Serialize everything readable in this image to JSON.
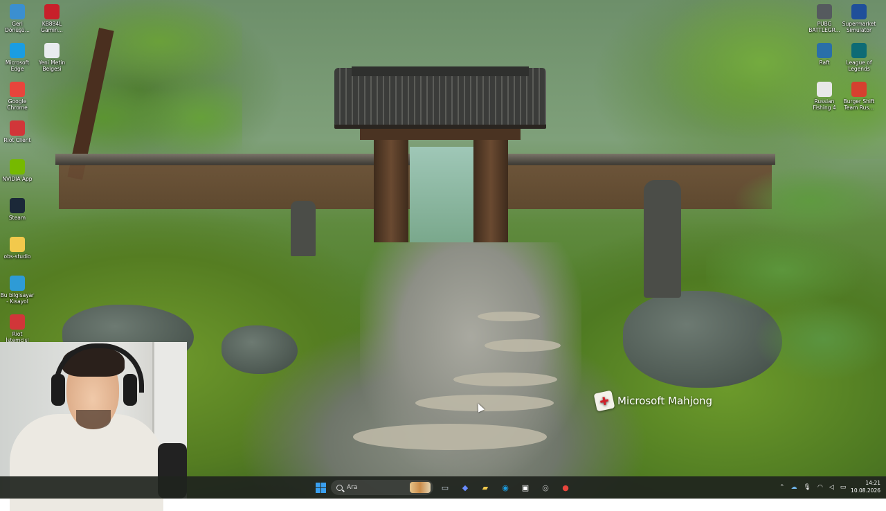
{
  "desktop_icons_left": [
    {
      "label": "Geri Dönüşü...",
      "icon": "recycle-bin-icon",
      "color": "#3b8fd0"
    },
    {
      "label": "KB884L Gamin...",
      "icon": "keyboard-app-icon",
      "color": "#c8202a"
    },
    {
      "label": "Microsoft Edge",
      "icon": "edge-icon",
      "color": "#1b9de2"
    },
    {
      "label": "Yeni Metin Belgesi",
      "icon": "text-document-icon",
      "color": "#e9ecef"
    },
    {
      "label": "Google Chrome",
      "icon": "chrome-icon",
      "color": "#e8453c"
    },
    {
      "label": "Riot Client",
      "icon": "riot-client-icon",
      "color": "#d13639"
    },
    {
      "label": "NVIDIA App",
      "icon": "nvidia-icon",
      "color": "#76b900"
    },
    {
      "label": "Steam",
      "icon": "steam-icon",
      "color": "#1b2838"
    },
    {
      "label": "obs-studio",
      "icon": "folder-icon",
      "color": "#f2c94c"
    },
    {
      "label": "Bu bilgisayar - Kısayol",
      "icon": "this-pc-icon",
      "color": "#2e9bd6"
    },
    {
      "label": "Riot İstemcisi",
      "icon": "riot-client-icon",
      "color": "#d13639"
    }
  ],
  "desktop_icons_right": [
    {
      "label": "PUBG BATTLEGR...",
      "icon": "pubg-icon",
      "color": "#555a5e"
    },
    {
      "label": "Supermarket Simulator",
      "icon": "supermarket-sim-icon",
      "color": "#1f4f9a"
    },
    {
      "label": "Raft",
      "icon": "raft-icon",
      "color": "#2a6fa8"
    },
    {
      "label": "League of Legends",
      "icon": "league-icon",
      "color": "#0e6b75"
    },
    {
      "label": "Russian Fishing 4",
      "icon": "russian-fishing-icon",
      "color": "#e8e8e8"
    },
    {
      "label": "Burger Shift Team Rus...",
      "icon": "burger-shift-icon",
      "color": "#d6402f"
    }
  ],
  "toast": {
    "label": "Microsoft Mahjong",
    "icon": "mahjong-icon"
  },
  "taskbar": {
    "search_placeholder": "Ara",
    "pinned": [
      {
        "name": "task-view-icon",
        "glyph": "▭",
        "color": "#cfd8e3"
      },
      {
        "name": "copilot-icon",
        "glyph": "◆",
        "color": "#6a8cff"
      },
      {
        "name": "file-explorer-icon",
        "glyph": "▰",
        "color": "#f2c94c"
      },
      {
        "name": "edge-icon",
        "glyph": "◉",
        "color": "#1b9de2"
      },
      {
        "name": "microsoft-store-icon",
        "glyph": "▣",
        "color": "#ffffff"
      },
      {
        "name": "game-app-icon",
        "glyph": "◎",
        "color": "#bbbbbb"
      },
      {
        "name": "chrome-icon",
        "glyph": "●",
        "color": "#e8453c"
      }
    ],
    "clock_time": "14:21",
    "clock_date": "10.08.2026"
  }
}
